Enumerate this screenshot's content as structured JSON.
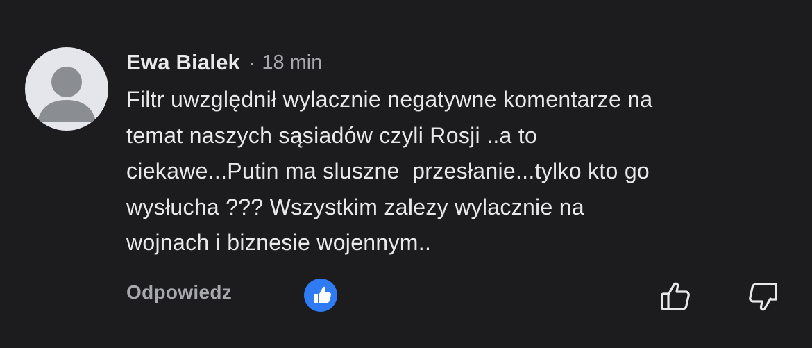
{
  "comment": {
    "author": "Ewa Bialek",
    "separator": "·",
    "time": "18 min",
    "text_lines": [
      "Filtr uwzględnił wylacznie negatywne komentarze na",
      "temat naszych sąsiadów czyli Rosji ..a to",
      "ciekawe...Putin ma sluszne  przesłanie...tylko kto go",
      "wysłucha ??? Wszystkim zalezy wylacznie na",
      "wojnach i biznesie wojennym.."
    ],
    "reply_label": "Odpowiedz"
  },
  "icons": {
    "avatar": "default-profile-icon",
    "reaction": "like-reaction-icon",
    "thumb_up": "thumbs-up-outline-icon",
    "thumb_down": "thumbs-down-outline-icon"
  },
  "colors": {
    "background": "#1c1b1d",
    "text": "#e9e9ea",
    "secondary_text": "#a7a8ab",
    "like_blue": "#2f7bf3",
    "avatar_bg": "#e4e6eb",
    "avatar_silhouette": "#8a8d91"
  }
}
